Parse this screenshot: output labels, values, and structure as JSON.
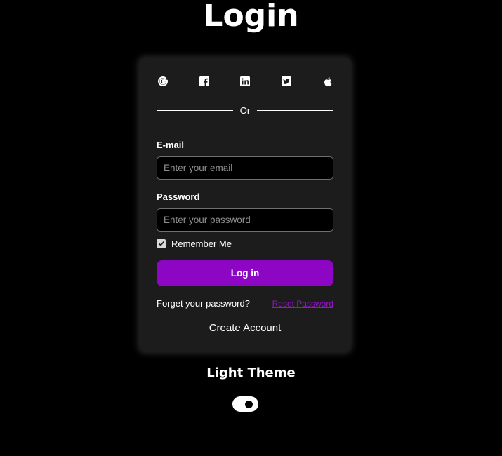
{
  "page": {
    "title": "Login"
  },
  "social": {
    "icons": [
      "google-icon",
      "facebook-icon",
      "linkedin-icon",
      "twitter-icon",
      "apple-icon"
    ]
  },
  "divider": {
    "text": "Or"
  },
  "email": {
    "label": "E-mail",
    "placeholder": "Enter your email",
    "value": ""
  },
  "password": {
    "label": "Password",
    "placeholder": "Enter your password",
    "value": ""
  },
  "remember": {
    "label": "Remember Me",
    "checked": true
  },
  "login_button": {
    "label": "Log in"
  },
  "forgot": {
    "text": "Forget your password?",
    "link": "Reset Password"
  },
  "create_account": {
    "label": "Create Account"
  },
  "theme": {
    "title": "Light Theme",
    "toggle_on": true
  },
  "colors": {
    "background": "#000000",
    "card": "#1c1c1d",
    "accent": "#8c06c4",
    "link": "#9a12cf"
  }
}
